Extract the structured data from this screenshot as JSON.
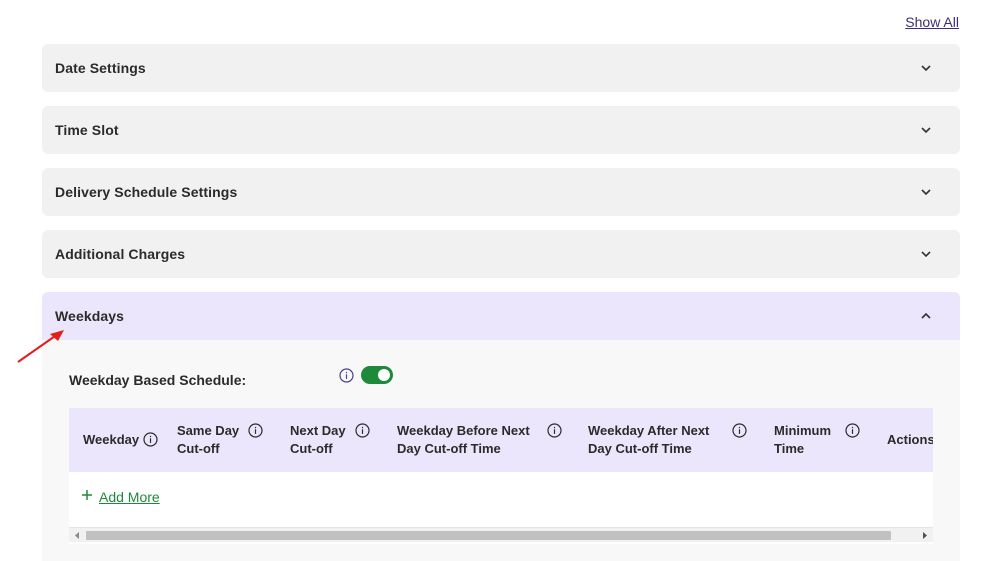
{
  "header": {
    "show_all": "Show All"
  },
  "panels": [
    {
      "title": "Date Settings"
    },
    {
      "title": "Time Slot"
    },
    {
      "title": "Delivery Schedule Settings"
    },
    {
      "title": "Additional Charges"
    }
  ],
  "weekdays": {
    "title": "Weekdays",
    "schedule_label": "Weekday Based Schedule:",
    "toggle_on": true,
    "columns": [
      {
        "line1": "Weekday",
        "line2": ""
      },
      {
        "line1": "Same Day",
        "line2": "Cut-off"
      },
      {
        "line1": "Next Day",
        "line2": "Cut-off"
      },
      {
        "line1": "Weekday Before Next",
        "line2": "Day Cut-off Time"
      },
      {
        "line1": "Weekday After Next",
        "line2": "Day Cut-off Time"
      },
      {
        "line1": "Minimum",
        "line2": "Time"
      },
      {
        "line1": "Actions",
        "line2": ""
      }
    ],
    "add_more": "Add More"
  },
  "colors": {
    "accent_green": "#1d8a3a",
    "header_purple": "#ebe6fb",
    "panel_gray": "#f1f1f1",
    "annotation_red": "#e0201b"
  },
  "icons": {
    "panel_chevron": "chevron-down-icon",
    "open_chevron": "chevron-up-icon",
    "info": "info-icon",
    "plus": "plus-icon",
    "annotation": "red-arrow"
  }
}
